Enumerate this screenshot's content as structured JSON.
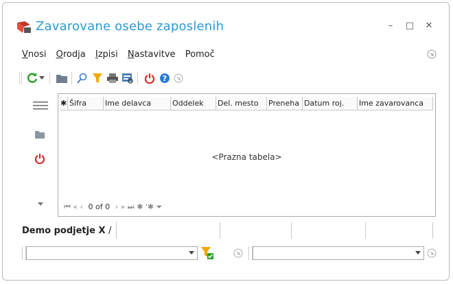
{
  "window": {
    "title": "Zavarovane osebe zaposlenih"
  },
  "menu": {
    "items": [
      {
        "label": "Vnosi",
        "underline": "V",
        "rest": "nosi"
      },
      {
        "label": "Orodja",
        "underline": "O",
        "rest": "rodja"
      },
      {
        "label": "Izpisi",
        "underline": "I",
        "rest": "zpisi"
      },
      {
        "label": "Nastavitve",
        "underline": "N",
        "rest": "astavitve"
      },
      {
        "label": "Pomoč",
        "underline": "",
        "rest": "Pomoč"
      }
    ]
  },
  "grid": {
    "columns": [
      "Šifra",
      "Ime delavca",
      "Oddelek",
      "Del. mesto",
      "Preneha",
      "Datum roj.",
      "Ime zavarovanca"
    ],
    "empty_text": "<Prazna tabela>",
    "nav_count": "0 of 0"
  },
  "bottom": {
    "tab_label": "Demo podjetje X",
    "tab_sep": "/"
  },
  "colors": {
    "title": "#2a9ad6",
    "refresh": "#2aa02a",
    "power": "#d42a2a",
    "help": "#2a7ad6",
    "filter": "#f0a800"
  }
}
